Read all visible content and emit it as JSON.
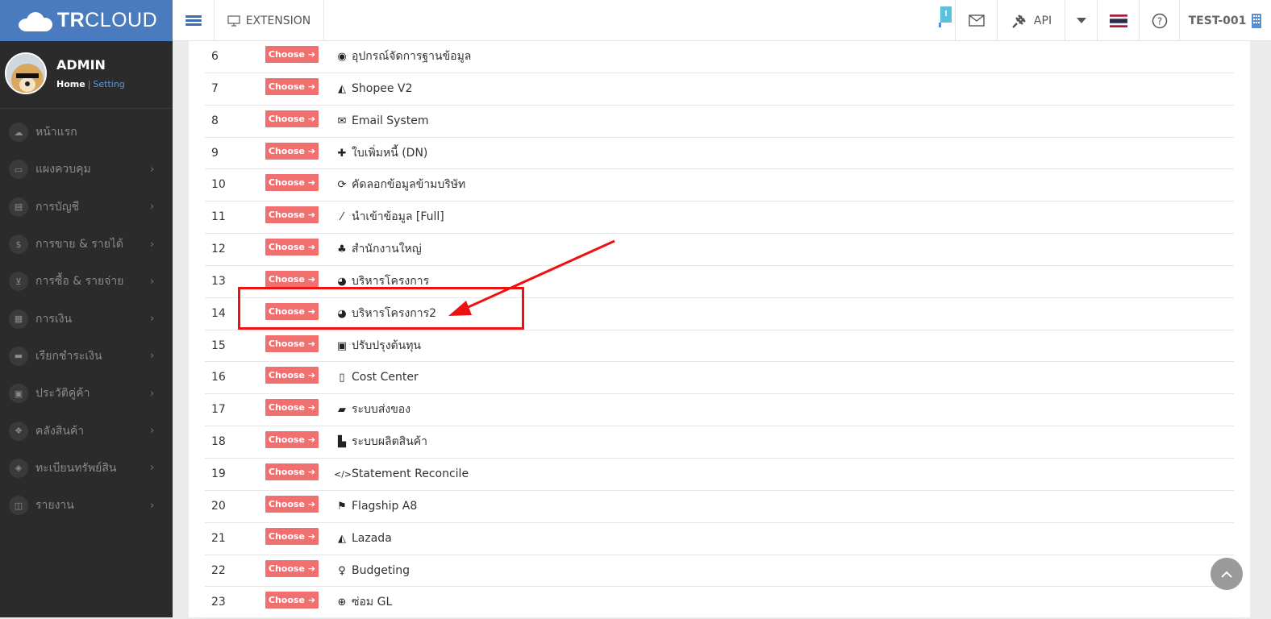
{
  "header": {
    "brand_bold": "TR",
    "brand_rest": "CLOUD",
    "extension_label": "EXTENSION",
    "api_label": "API",
    "company_label": "TEST-001",
    "notification_badge": "!"
  },
  "profile": {
    "name": "ADMIN",
    "home_link": "Home",
    "separator": "|",
    "setting_link": "Setting"
  },
  "sidebar": {
    "items": [
      {
        "label": "หน้าแรก",
        "icon": "cloud-icon",
        "has_arrow": false
      },
      {
        "label": "แผงควบคุม",
        "icon": "monitor-icon",
        "has_arrow": true
      },
      {
        "label": "การบัญชี",
        "icon": "book-icon",
        "has_arrow": true
      },
      {
        "label": "การขาย & รายได้",
        "icon": "dollar-icon",
        "has_arrow": true
      },
      {
        "label": "การซื้อ & รายจ่าย",
        "icon": "cart-icon",
        "has_arrow": true
      },
      {
        "label": "การเงิน",
        "icon": "calendar-icon",
        "has_arrow": true
      },
      {
        "label": "เรียกชำระเงิน",
        "icon": "card-icon",
        "has_arrow": true
      },
      {
        "label": "ประวัติคู่ค้า",
        "icon": "contact-icon",
        "has_arrow": true
      },
      {
        "label": "คลังสินค้า",
        "icon": "cubes-icon",
        "has_arrow": true
      },
      {
        "label": "ทะเบียนทรัพย์สิน",
        "icon": "diamond-icon",
        "has_arrow": true
      },
      {
        "label": "รายงาน",
        "icon": "report-icon",
        "has_arrow": true
      }
    ]
  },
  "table": {
    "choose_label": "Choose",
    "rows": [
      {
        "num": "6",
        "icon": "gamepad-icon",
        "glyph": "◉",
        "name": "อุปกรณ์จัดการฐานข้อมูล"
      },
      {
        "num": "7",
        "icon": "shopping-bag-icon",
        "glyph": "◭",
        "name": "Shopee V2"
      },
      {
        "num": "8",
        "icon": "envelope-icon",
        "glyph": "✉",
        "name": "Email System"
      },
      {
        "num": "9",
        "icon": "plus-icon",
        "glyph": "✚",
        "name": "ใบเพิ่มหนี้ (DN)"
      },
      {
        "num": "10",
        "icon": "refresh-icon",
        "glyph": "⟳",
        "name": "คัดลอกข้อมูลข้ามบริษัท"
      },
      {
        "num": "11",
        "icon": "magic-wand-icon",
        "glyph": "⁄",
        "name": "นำเข้าข้อมูล [Full]"
      },
      {
        "num": "12",
        "icon": "sitemap-icon",
        "glyph": "♣",
        "name": "สำนักงานใหญ่"
      },
      {
        "num": "13",
        "icon": "pie-chart-icon",
        "glyph": "◕",
        "name": "บริหารโครงการ"
      },
      {
        "num": "14",
        "icon": "pie-chart-icon",
        "glyph": "◕",
        "name": "บริหารโครงการ2"
      },
      {
        "num": "15",
        "icon": "bus-icon",
        "glyph": "▣",
        "name": "ปรับปรุงต้นทุน"
      },
      {
        "num": "16",
        "icon": "tablet-icon",
        "glyph": "▯",
        "name": "Cost Center"
      },
      {
        "num": "17",
        "icon": "truck-icon",
        "glyph": "▰",
        "name": "ระบบส่งของ"
      },
      {
        "num": "18",
        "icon": "industry-icon",
        "glyph": "▙",
        "name": "ระบบผลิตสินค้า"
      },
      {
        "num": "19",
        "icon": "code-icon",
        "glyph": "</>",
        "name": "Statement Reconcile"
      },
      {
        "num": "20",
        "icon": "flag-icon",
        "glyph": "⚑",
        "name": "Flagship A8"
      },
      {
        "num": "21",
        "icon": "shopping-bag-icon",
        "glyph": "◭",
        "name": "Lazada"
      },
      {
        "num": "22",
        "icon": "lightbulb-icon",
        "glyph": "♀",
        "name": "Budgeting"
      },
      {
        "num": "23",
        "icon": "life-ring-icon",
        "glyph": "⊕",
        "name": "ซ่อม GL"
      }
    ]
  },
  "annotation": {
    "highlight_color": "#ee1111",
    "highlighted_row": "14"
  },
  "colors": {
    "brand_blue": "#4a7bbf",
    "sidebar_bg": "#2b2b2b",
    "choose_button": "#f07070"
  }
}
